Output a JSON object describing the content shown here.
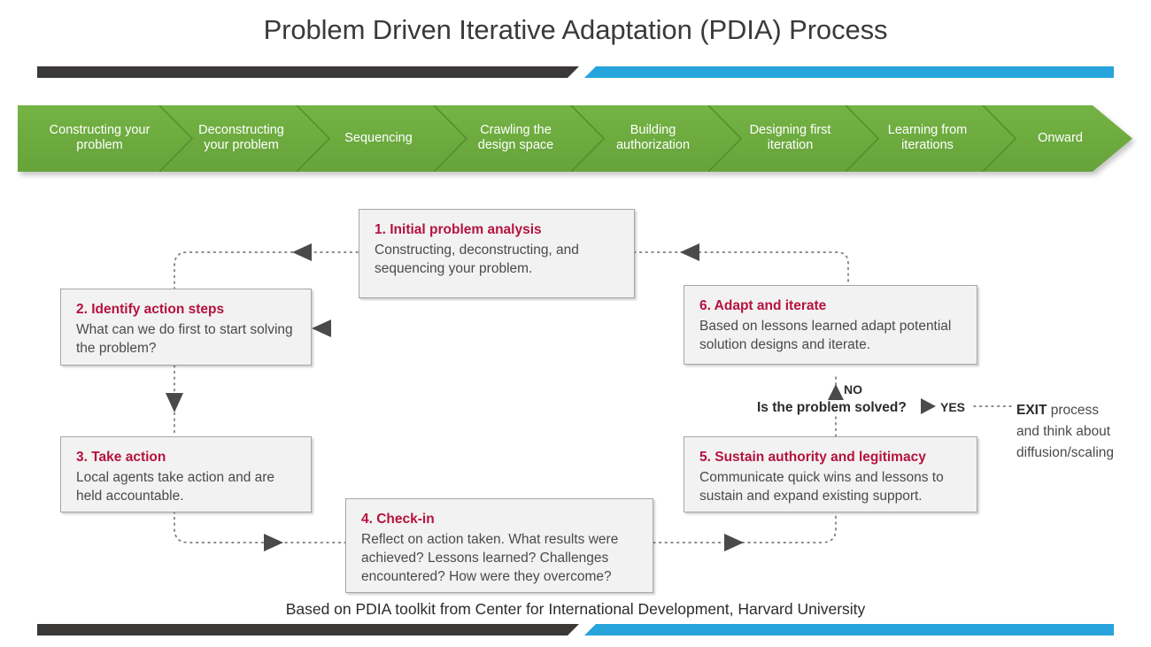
{
  "slide": {
    "title": "Problem Driven Iterative Adaptation (PDIA) Process",
    "footer": "Based on PDIA toolkit from Center for International Development, Harvard University"
  },
  "theme": {
    "bar_dark": "#3b3838",
    "bar_blue": "#27a4dc",
    "chevron_green": "#6cac3f",
    "heading_red": "#b5123e",
    "body_gray": "#4a4a4a",
    "box_fill": "#f2f2f2",
    "box_border": "#a6a6a6",
    "arrow_gray": "#4a4a4a"
  },
  "process_band": {
    "steps": [
      {
        "label": "Constructing your\nproblem"
      },
      {
        "label": "Deconstructing\nyour problem"
      },
      {
        "label": "Sequencing"
      },
      {
        "label": "Crawling the\ndesign space"
      },
      {
        "label": "Building\nauthorization"
      },
      {
        "label": "Designing first\niteration"
      },
      {
        "label": "Learning from\niterations"
      },
      {
        "label": "Onward"
      }
    ]
  },
  "cycle": {
    "boxes": [
      {
        "id": "step-1",
        "heading": "1. Initial problem analysis",
        "body": "Constructing, deconstructing, and sequencing your problem."
      },
      {
        "id": "step-2",
        "heading": "2. Identify action steps",
        "body": "What can we do first to start solving the problem?"
      },
      {
        "id": "step-3",
        "heading": "3. Take action",
        "body": "Local agents take action and are held accountable."
      },
      {
        "id": "step-4",
        "heading": "4. Check-in",
        "body": "Reflect on action taken. What results were achieved? Lessons learned? Challenges encountered? How were they overcome?"
      },
      {
        "id": "step-5",
        "heading": "5. Sustain authority and legitimacy",
        "body": "Communicate quick wins and lessons to sustain and expand existing support."
      },
      {
        "id": "step-6",
        "heading": "6. Adapt and iterate",
        "body": "Based on lessons learned adapt potential solution designs and iterate."
      }
    ]
  },
  "decision": {
    "question": "Is the problem solved?",
    "no_label": "NO",
    "yes_label": "YES",
    "exit_line_1_bold": "EXIT",
    "exit_line_1_rest": " process",
    "exit_line_2": "and think about",
    "exit_line_3": "diffusion/scaling"
  }
}
